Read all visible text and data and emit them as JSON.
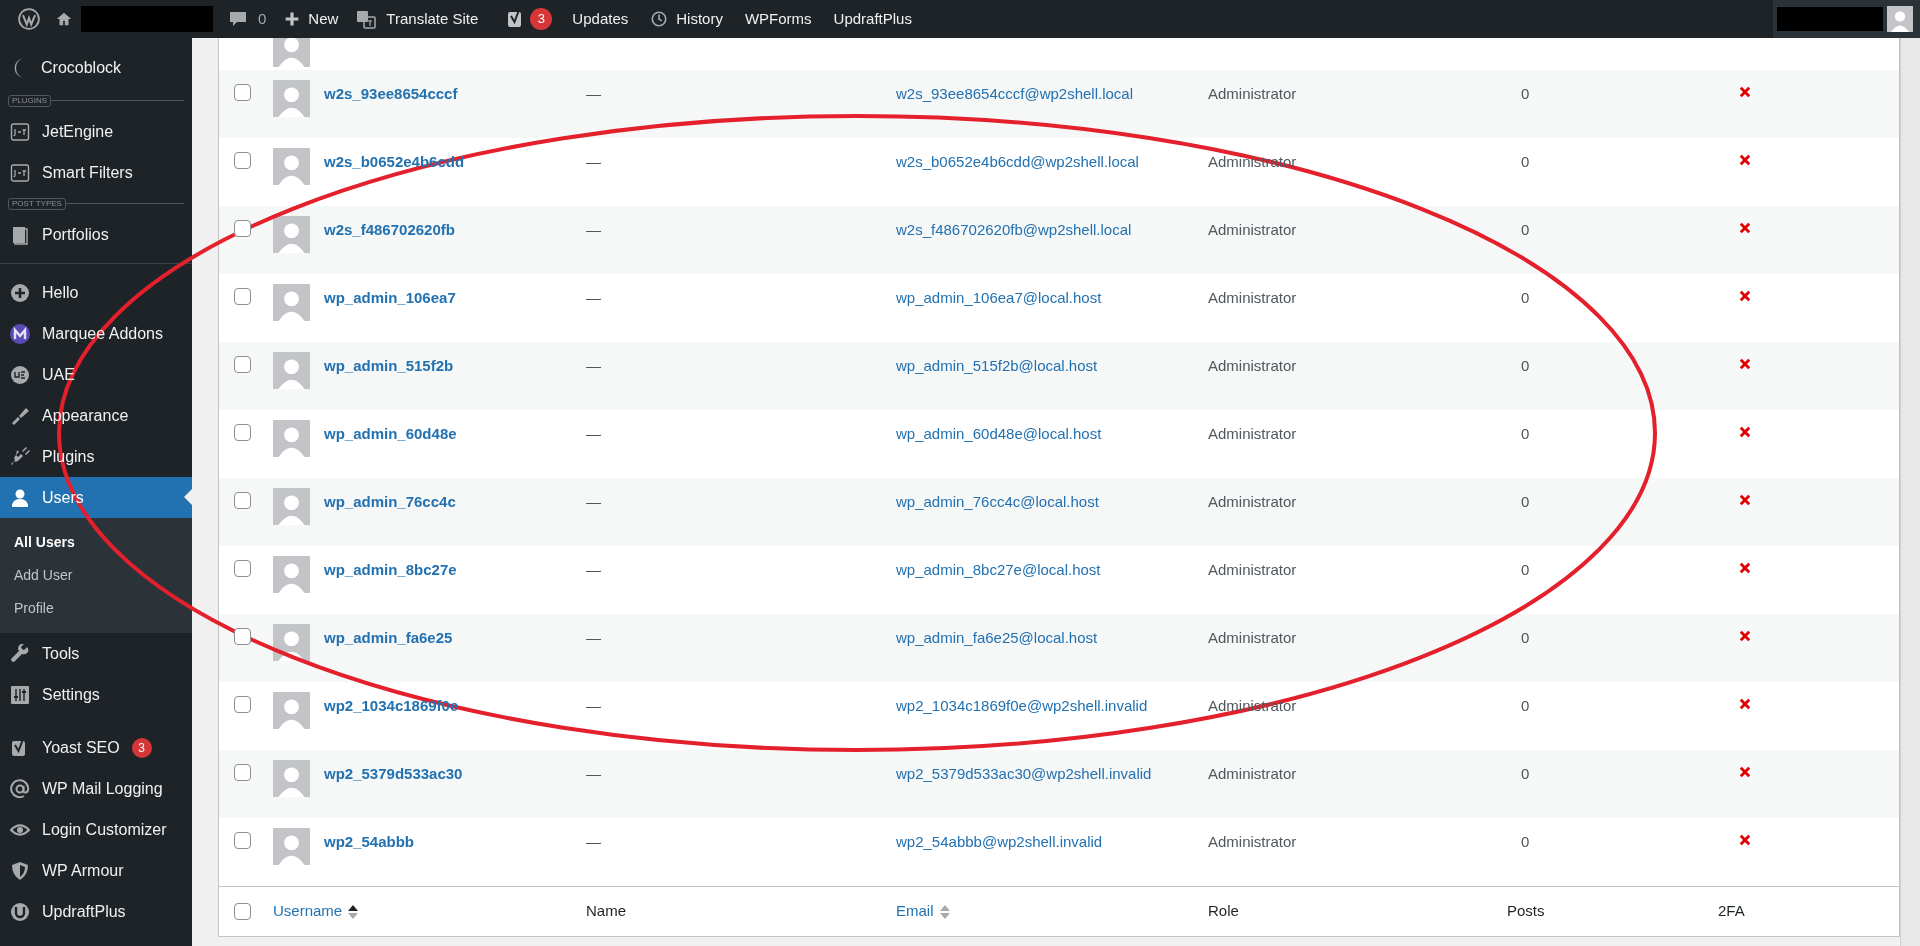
{
  "admin_bar": {
    "comments_count": "0",
    "new_label": "New",
    "translate_label": "Translate Site",
    "seo_badge": "3",
    "links": [
      "Updates",
      "History",
      "WPForms",
      "UpdraftPlus"
    ]
  },
  "sidebar": {
    "items": [
      {
        "kind": "item",
        "label": "Crocoblock",
        "selected": false
      },
      {
        "kind": "label",
        "label": "PLUGINS"
      },
      {
        "kind": "item",
        "label": "JetEngine",
        "selected": false
      },
      {
        "kind": "item",
        "label": "Smart Filters",
        "selected": false
      },
      {
        "kind": "label",
        "label": "POST TYPES"
      },
      {
        "kind": "item",
        "label": "Portfolios",
        "selected": false
      },
      {
        "kind": "separator"
      },
      {
        "kind": "item",
        "label": "Hello",
        "selected": false
      },
      {
        "kind": "item",
        "label": "Marquee Addons",
        "selected": false
      },
      {
        "kind": "item",
        "label": "UAE",
        "selected": false
      },
      {
        "kind": "item",
        "label": "Appearance",
        "selected": false
      },
      {
        "kind": "item",
        "label": "Plugins",
        "selected": false
      },
      {
        "kind": "item",
        "label": "Users",
        "selected": true,
        "children": [
          {
            "label": "All Users",
            "selected": true
          },
          {
            "label": "Add User",
            "selected": false
          },
          {
            "label": "Profile",
            "selected": false
          }
        ]
      },
      {
        "kind": "item",
        "label": "Tools",
        "selected": false
      },
      {
        "kind": "item",
        "label": "Settings",
        "selected": false
      },
      {
        "kind": "gap"
      },
      {
        "kind": "item",
        "label": "Yoast SEO",
        "selected": false,
        "badge": "3"
      },
      {
        "kind": "item",
        "label": "WP Mail Logging",
        "selected": false
      },
      {
        "kind": "item",
        "label": "Login Customizer",
        "selected": false
      },
      {
        "kind": "item",
        "label": "WP Armour",
        "selected": false
      },
      {
        "kind": "item",
        "label": "UpdraftPlus",
        "selected": false
      }
    ]
  },
  "table": {
    "rows": [
      {
        "username": "w2s_93ee8654cccf",
        "name": "—",
        "email": "w2s_93ee8654cccf@wp2shell.local",
        "role": "Administrator",
        "posts": "0",
        "two_factor": false,
        "checked": false
      },
      {
        "username": "w2s_b0652e4b6cdd",
        "name": "—",
        "email": "w2s_b0652e4b6cdd@wp2shell.local",
        "role": "Administrator",
        "posts": "0",
        "two_factor": false,
        "checked": false
      },
      {
        "username": "w2s_f486702620fb",
        "name": "—",
        "email": "w2s_f486702620fb@wp2shell.local",
        "role": "Administrator",
        "posts": "0",
        "two_factor": false,
        "checked": false
      },
      {
        "username": "wp_admin_106ea7",
        "name": "—",
        "email": "wp_admin_106ea7@local.host",
        "role": "Administrator",
        "posts": "0",
        "two_factor": false,
        "checked": false
      },
      {
        "username": "wp_admin_515f2b",
        "name": "—",
        "email": "wp_admin_515f2b@local.host",
        "role": "Administrator",
        "posts": "0",
        "two_factor": false,
        "checked": false
      },
      {
        "username": "wp_admin_60d48e",
        "name": "—",
        "email": "wp_admin_60d48e@local.host",
        "role": "Administrator",
        "posts": "0",
        "two_factor": false,
        "checked": false
      },
      {
        "username": "wp_admin_76cc4c",
        "name": "—",
        "email": "wp_admin_76cc4c@local.host",
        "role": "Administrator",
        "posts": "0",
        "two_factor": false,
        "checked": false
      },
      {
        "username": "wp_admin_8bc27e",
        "name": "—",
        "email": "wp_admin_8bc27e@local.host",
        "role": "Administrator",
        "posts": "0",
        "two_factor": false,
        "checked": false
      },
      {
        "username": "wp_admin_fa6e25",
        "name": "—",
        "email": "wp_admin_fa6e25@local.host",
        "role": "Administrator",
        "posts": "0",
        "two_factor": false,
        "checked": false
      },
      {
        "username": "wp2_1034c1869f0e",
        "name": "—",
        "email": "wp2_1034c1869f0e@wp2shell.invalid",
        "role": "Administrator",
        "posts": "0",
        "two_factor": false,
        "checked": false
      },
      {
        "username": "wp2_5379d533ac30",
        "name": "—",
        "email": "wp2_5379d533ac30@wp2shell.invalid",
        "role": "Administrator",
        "posts": "0",
        "two_factor": false,
        "checked": false
      },
      {
        "username": "wp2_54abbb",
        "name": "—",
        "email": "wp2_54abbb@wp2shell.invalid",
        "role": "Administrator",
        "posts": "0",
        "two_factor": false,
        "checked": false
      }
    ],
    "footer_checked": false,
    "columns": [
      {
        "label": "Username",
        "sortable": true,
        "sorted": true
      },
      {
        "label": "Name",
        "sortable": false
      },
      {
        "label": "Email",
        "sortable": true,
        "sorted": false
      },
      {
        "label": "Role",
        "sortable": false
      },
      {
        "label": "Posts",
        "sortable": false
      },
      {
        "label": "2FA",
        "sortable": false
      }
    ]
  }
}
